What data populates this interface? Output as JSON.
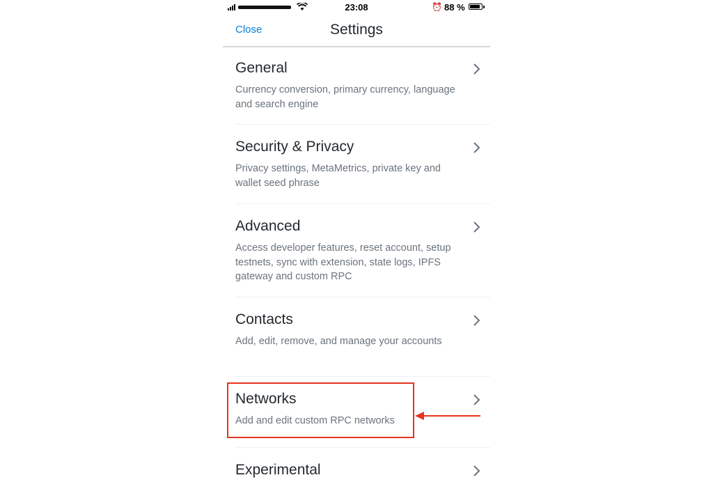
{
  "status_bar": {
    "time": "23:08",
    "battery_percent": "88 %",
    "battery_level": 0.88,
    "alarm_icon": "alarm-clock-icon"
  },
  "header": {
    "close_label": "Close",
    "title": "Settings"
  },
  "items": [
    {
      "title": "General",
      "description": "Currency conversion, primary currency, language and search engine"
    },
    {
      "title": "Security & Privacy",
      "description": "Privacy settings, MetaMetrics, private key and wallet seed phrase"
    },
    {
      "title": "Advanced",
      "description": "Access developer features, reset account, setup testnets, sync with extension, state logs, IPFS gateway and custom RPC"
    },
    {
      "title": "Contacts",
      "description": "Add, edit, remove, and manage your accounts"
    },
    {
      "title": "Networks",
      "description": "Add and edit custom RPC networks"
    },
    {
      "title": "Experimental",
      "description": ""
    }
  ],
  "annotation": {
    "highlighted_item": "Networks",
    "color": "#e8331f"
  },
  "colors": {
    "accent": "#037dd6",
    "text": "#24292e",
    "muted": "#6a737d",
    "divider": "#d6d9dc"
  }
}
